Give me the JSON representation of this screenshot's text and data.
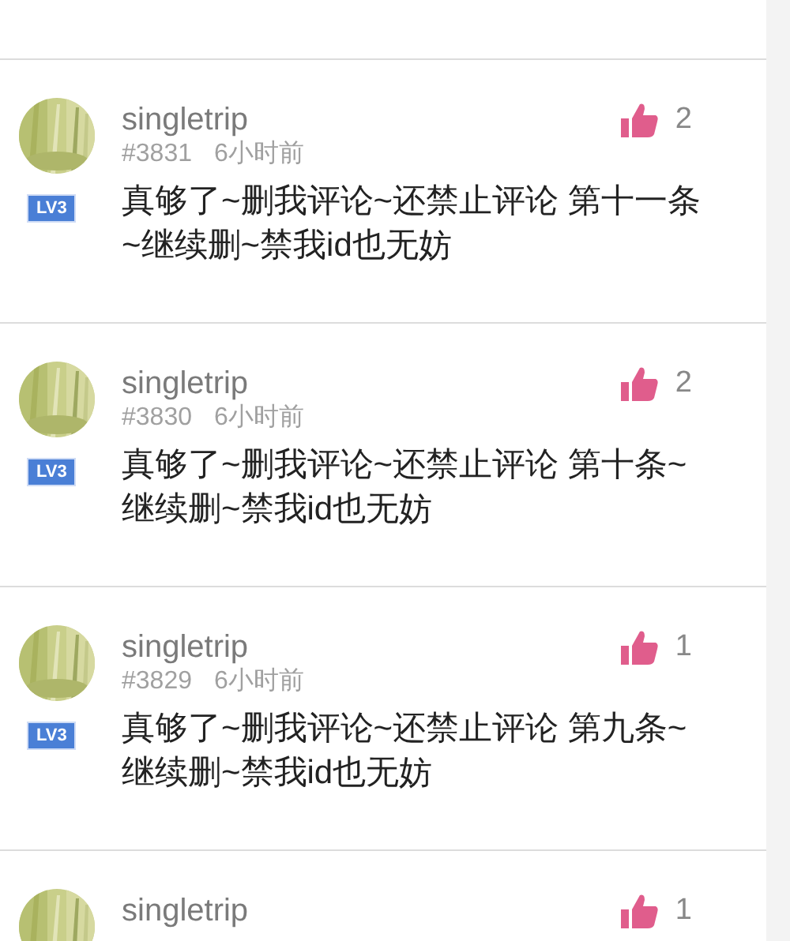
{
  "comments": [
    {
      "user": "singletrip",
      "number": "#3831",
      "time": "6小时前",
      "likes": "2",
      "badge": "LV3",
      "text": "真够了~删我评论~还禁止评论 第十一条~继续删~禁我id也无妨"
    },
    {
      "user": "singletrip",
      "number": "#3830",
      "time": "6小时前",
      "likes": "2",
      "badge": "LV3",
      "text": "真够了~删我评论~还禁止评论 第十条~继续删~禁我id也无妨"
    },
    {
      "user": "singletrip",
      "number": "#3829",
      "time": "6小时前",
      "likes": "1",
      "badge": "LV3",
      "text": "真够了~删我评论~还禁止评论 第九条~继续删~禁我id也无妨"
    },
    {
      "user": "singletrip",
      "likes": "1"
    }
  ]
}
